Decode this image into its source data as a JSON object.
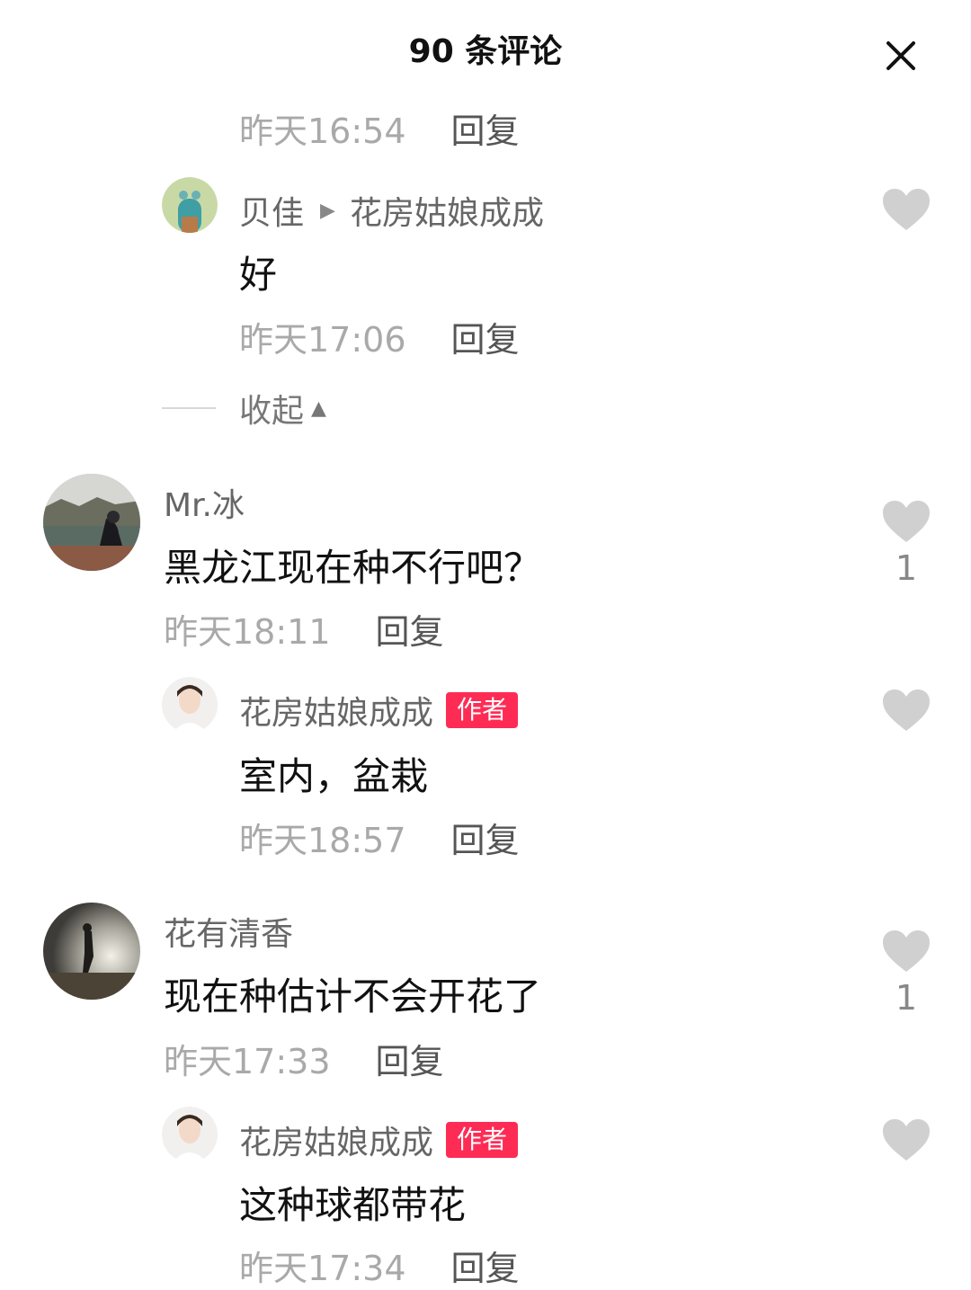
{
  "header": {
    "title": "90 条评论",
    "close_icon": "close-icon"
  },
  "top_reply": {
    "time": "昨天16:54",
    "reply": "回复"
  },
  "reply_beijia": {
    "name": "贝佳",
    "to": "花房姑娘成成",
    "text": "好",
    "time": "昨天17:06",
    "reply": "回复"
  },
  "collapse": {
    "label": "收起"
  },
  "comment_mrbing": {
    "name": "Mr.冰",
    "text": "黑龙江现在种不行吧？",
    "time": "昨天18:11",
    "reply": "回复",
    "likes": "1"
  },
  "reply_author_1": {
    "name": "花房姑娘成成",
    "badge": "作者",
    "text": "室内，盆栽",
    "time": "昨天18:57",
    "reply": "回复"
  },
  "comment_huayou": {
    "name": "花有清香",
    "text": "现在种估计不会开花了",
    "time": "昨天17:33",
    "reply": "回复",
    "likes": "1"
  },
  "reply_author_2": {
    "name": "花房姑娘成成",
    "badge": "作者",
    "text": "这种球都带花",
    "time": "昨天17:34",
    "reply": "回复"
  },
  "colors": {
    "accent": "#fe2c55",
    "heart": "#d0d0d0"
  }
}
